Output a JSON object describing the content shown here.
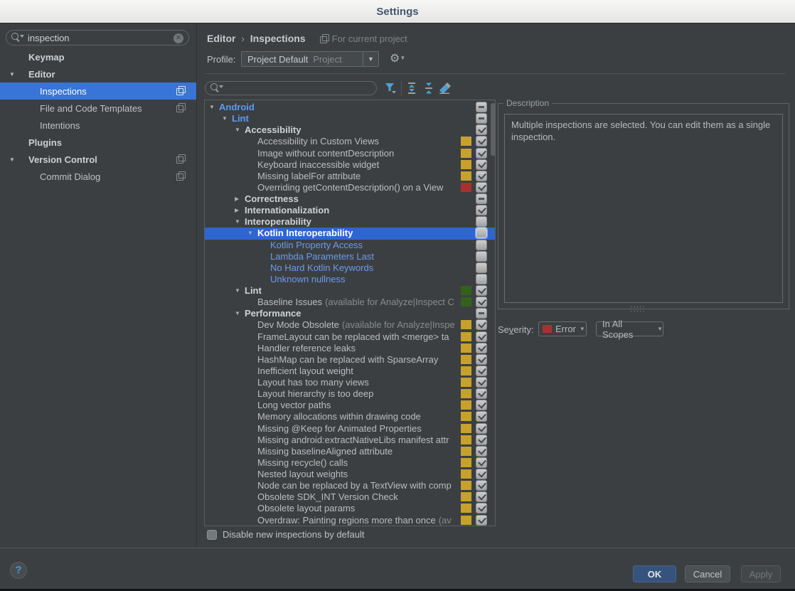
{
  "window": {
    "title": "Settings"
  },
  "icons": {
    "sidebar_search": "magnifier-with-dropdown",
    "sidebar_clear": "circle-x",
    "scope_badge": "copy-pages",
    "profile_menu": "gear-with-dropdown",
    "tree_filter": "funnel-with-dropdown",
    "tree_expand": "expand-all",
    "tree_collapse": "collapse-all",
    "tree_reset": "eraser",
    "help": "question-mark-circle"
  },
  "sidebar": {
    "search": {
      "value": "inspection",
      "clear_glyph": "✕"
    },
    "items": [
      {
        "label": "Keymap",
        "bold": true,
        "indent": 1
      },
      {
        "label": "Editor",
        "bold": true,
        "indent": 0,
        "arrow": "down"
      },
      {
        "label": "Inspections",
        "indent": 2,
        "selected": true,
        "icon": "copy-pages"
      },
      {
        "label": "File and Code Templates",
        "indent": 2,
        "icon": "copy-pages"
      },
      {
        "label": "Intentions",
        "indent": 2
      },
      {
        "label": "Plugins",
        "bold": true,
        "indent": 1
      },
      {
        "label": "Version Control",
        "bold": true,
        "indent": 0,
        "arrow": "down",
        "icon": "copy-pages"
      },
      {
        "label": "Commit Dialog",
        "indent": 2,
        "icon": "copy-pages"
      }
    ]
  },
  "header": {
    "section": "Editor",
    "separator": "›",
    "page": "Inspections",
    "scope_note": "For current project"
  },
  "profile": {
    "label": "Profile:",
    "value": "Project Default",
    "value_suffix": "Project"
  },
  "tree": {
    "colors": {
      "yellow": "#c6a22d",
      "red": "#a8312e",
      "green": "#33611c",
      "selection": "#2e65d2"
    },
    "rows": [
      {
        "level": 0,
        "arrow": "d",
        "label": "Android",
        "style": "gb",
        "check": "dash"
      },
      {
        "level": 1,
        "arrow": "d",
        "label": "Lint",
        "style": "gb",
        "check": "dash"
      },
      {
        "level": 2,
        "arrow": "d",
        "label": "Accessibility",
        "style": "g",
        "check": "on"
      },
      {
        "level": 3,
        "label": "Accessibility in Custom Views",
        "style": "i",
        "color": "yellow",
        "check": "on"
      },
      {
        "level": 3,
        "label": "Image without contentDescription",
        "style": "i",
        "color": "yellow",
        "check": "on"
      },
      {
        "level": 3,
        "label": "Keyboard inaccessible widget",
        "style": "i",
        "color": "yellow",
        "check": "on"
      },
      {
        "level": 3,
        "label": "Missing labelFor attribute",
        "style": "i",
        "color": "yellow",
        "check": "on"
      },
      {
        "level": 3,
        "label": "Overriding getContentDescription() on a View",
        "style": "i",
        "color": "red",
        "check": "on"
      },
      {
        "level": 2,
        "arrow": "r",
        "label": "Correctness",
        "style": "g",
        "check": "dash"
      },
      {
        "level": 2,
        "arrow": "r",
        "label": "Internationalization",
        "style": "g",
        "check": "on"
      },
      {
        "level": 2,
        "arrow": "d",
        "label": "Interoperability",
        "style": "g",
        "check": "off"
      },
      {
        "level": 3,
        "arrow": "d",
        "label": "Kotlin Interoperability",
        "style": "g",
        "check": "off",
        "selected": true
      },
      {
        "level": 4,
        "label": "Kotlin Property Access",
        "style": "ib",
        "check": "off"
      },
      {
        "level": 4,
        "label": "Lambda Parameters Last",
        "style": "ib",
        "check": "off"
      },
      {
        "level": 4,
        "label": "No Hard Kotlin Keywords",
        "style": "ib",
        "check": "off"
      },
      {
        "level": 4,
        "label": "Unknown nullness",
        "style": "ib",
        "check": "off"
      },
      {
        "level": 2,
        "arrow": "d",
        "label": "Lint",
        "style": "g",
        "color": "green",
        "check": "on"
      },
      {
        "level": 3,
        "label": "Baseline Issues",
        "note": "(available for Analyze|Inspect C",
        "style": "i",
        "color": "green",
        "check": "on"
      },
      {
        "level": 2,
        "arrow": "d",
        "label": "Performance",
        "style": "g",
        "check": "dash"
      },
      {
        "level": 3,
        "label": "Dev Mode Obsolete",
        "note": "(available for Analyze|Inspe",
        "style": "i",
        "color": "yellow",
        "check": "on"
      },
      {
        "level": 3,
        "label": "FrameLayout can be replaced with <merge> ta",
        "style": "i",
        "color": "yellow",
        "check": "on"
      },
      {
        "level": 3,
        "label": "Handler reference leaks",
        "style": "i",
        "color": "yellow",
        "check": "on"
      },
      {
        "level": 3,
        "label": "HashMap can be replaced with SparseArray",
        "style": "i",
        "color": "yellow",
        "check": "on"
      },
      {
        "level": 3,
        "label": "Inefficient layout weight",
        "style": "i",
        "color": "yellow",
        "check": "on"
      },
      {
        "level": 3,
        "label": "Layout has too many views",
        "style": "i",
        "color": "yellow",
        "check": "on"
      },
      {
        "level": 3,
        "label": "Layout hierarchy is too deep",
        "style": "i",
        "color": "yellow",
        "check": "on"
      },
      {
        "level": 3,
        "label": "Long vector paths",
        "style": "i",
        "color": "yellow",
        "check": "on"
      },
      {
        "level": 3,
        "label": "Memory allocations within drawing code",
        "style": "i",
        "color": "yellow",
        "check": "on"
      },
      {
        "level": 3,
        "label": "Missing @Keep for Animated Properties",
        "style": "i",
        "color": "yellow",
        "check": "on"
      },
      {
        "level": 3,
        "label": "Missing android:extractNativeLibs manifest attr",
        "style": "i",
        "color": "yellow",
        "check": "on"
      },
      {
        "level": 3,
        "label": "Missing baselineAligned attribute",
        "style": "i",
        "color": "yellow",
        "check": "on"
      },
      {
        "level": 3,
        "label": "Missing recycle() calls",
        "style": "i",
        "color": "yellow",
        "check": "on"
      },
      {
        "level": 3,
        "label": "Nested layout weights",
        "style": "i",
        "color": "yellow",
        "check": "on"
      },
      {
        "level": 3,
        "label": "Node can be replaced by a TextView with comp",
        "style": "i",
        "color": "yellow",
        "check": "on"
      },
      {
        "level": 3,
        "label": "Obsolete SDK_INT Version Check",
        "style": "i",
        "color": "yellow",
        "check": "on"
      },
      {
        "level": 3,
        "label": "Obsolete layout params",
        "style": "i",
        "color": "yellow",
        "check": "on"
      },
      {
        "level": 3,
        "label": "Overdraw: Painting regions more than once",
        "note": "(av",
        "style": "i",
        "color": "yellow",
        "check": "on"
      },
      {
        "level": 3,
        "label": "",
        "style": "i",
        "color": "yellow",
        "check": "on"
      }
    ]
  },
  "description": {
    "title": "Description",
    "text": "Multiple inspections are selected. You can edit them as a single inspection."
  },
  "severity": {
    "label_pre": "Se",
    "label_mn": "v",
    "label_post": "erity:",
    "value": "Error",
    "value_color": "#a8312e",
    "scope": "In All Scopes"
  },
  "footer": {
    "disable_label": "Disable new inspections by default",
    "ok": "OK",
    "cancel": "Cancel",
    "apply": "Apply",
    "help": "?"
  }
}
